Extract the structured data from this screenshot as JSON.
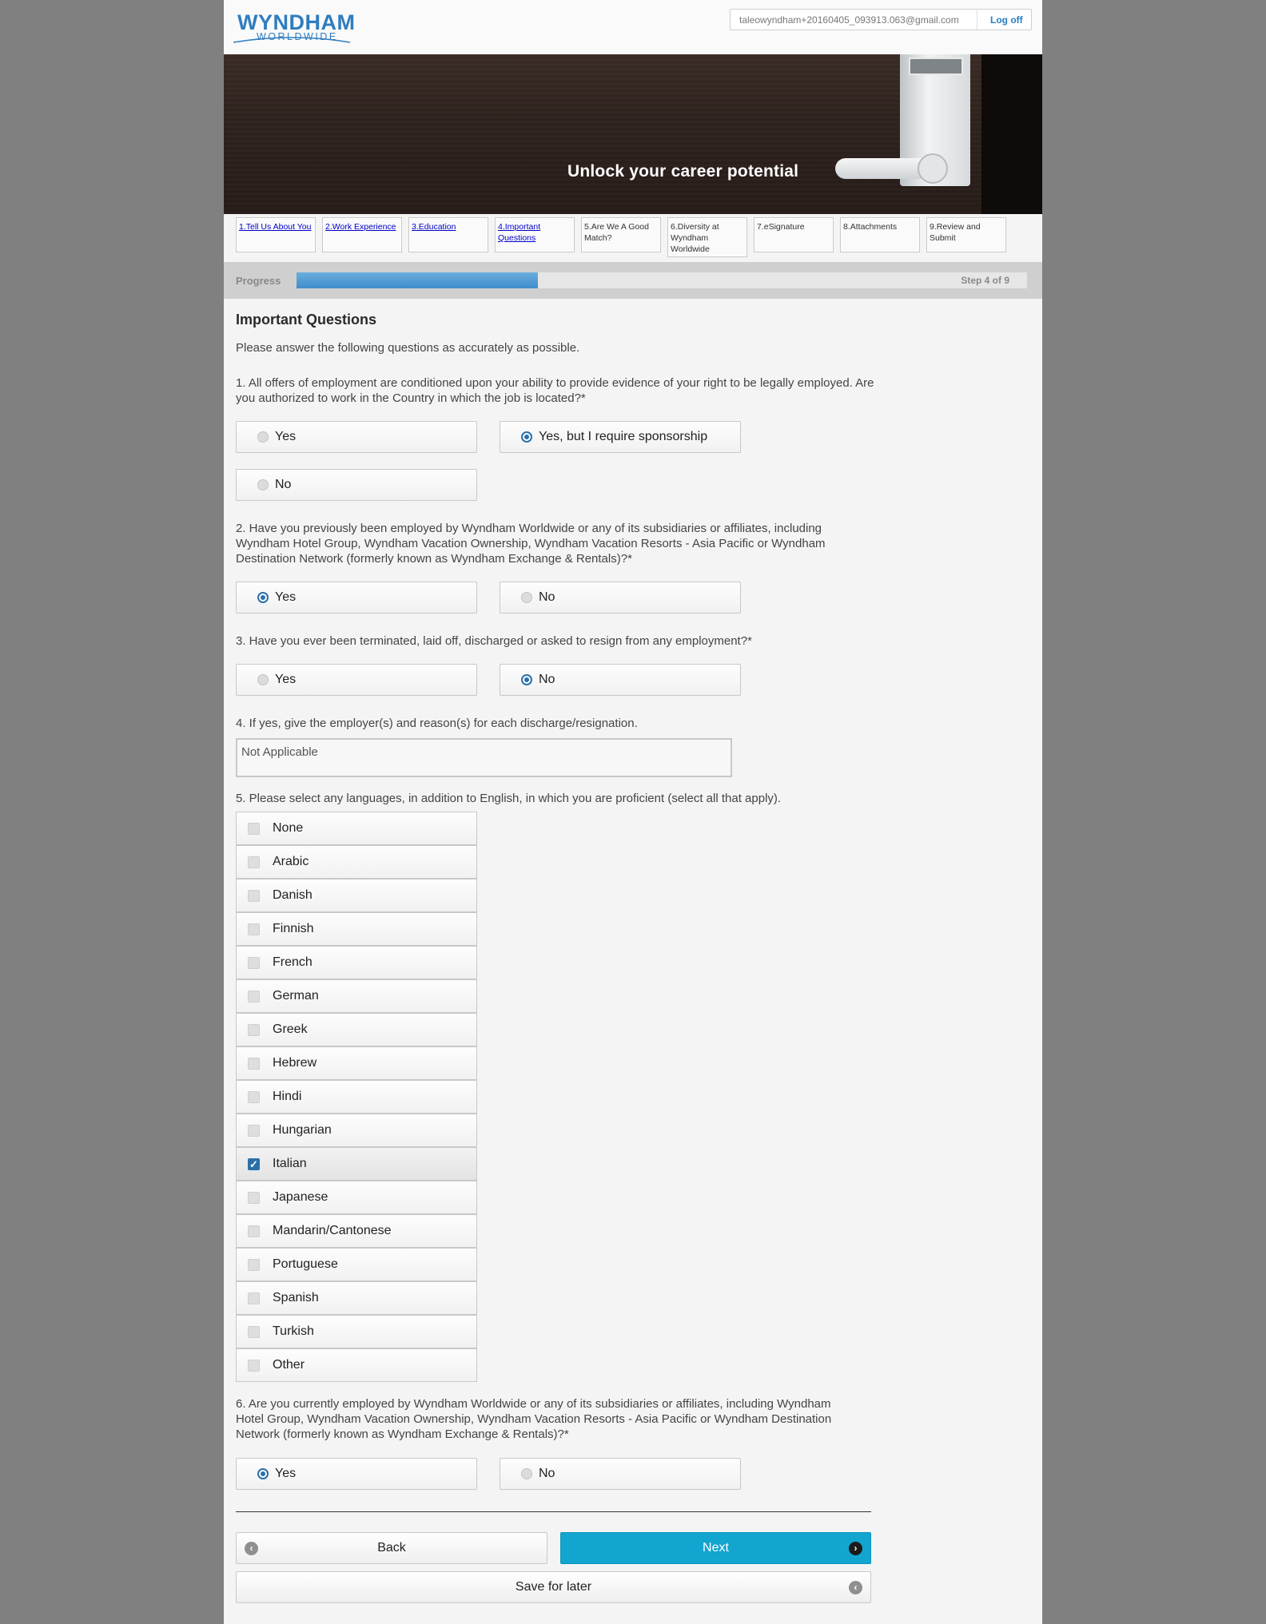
{
  "header": {
    "logo_line1": "WYNDHAM",
    "logo_line2": "WORLDWIDE",
    "user_email": "taleowyndham+20160405_093913.063@gmail.com",
    "logoff_label": "Log off"
  },
  "banner": {
    "tagline": "Unlock your career potential"
  },
  "steps": [
    {
      "label": "1.Tell Us About You",
      "link": true
    },
    {
      "label": "2.Work Experience",
      "link": true
    },
    {
      "label": "3.Education",
      "link": true
    },
    {
      "label": "4.Important Questions",
      "link": true
    },
    {
      "label": "5.Are We A Good Match?",
      "link": false
    },
    {
      "label": "6.Diversity at Wyndham Worldwide",
      "link": false
    },
    {
      "label": "7.eSignature",
      "link": false
    },
    {
      "label": "8.Attachments",
      "link": false
    },
    {
      "label": "9.Review and Submit",
      "link": false
    }
  ],
  "progress": {
    "label": "Progress",
    "step_text": "Step 4 of 9",
    "fraction": 0.33
  },
  "form": {
    "title": "Important Questions",
    "intro": "Please answer the following questions as accurately as possible.",
    "q1": {
      "text": "1. All offers of employment are conditioned upon your ability to provide evidence of your right to be legally employed. Are you authorized to work in the Country in which the job is located?*",
      "options": [
        "Yes",
        "Yes, but I require sponsorship",
        "No"
      ],
      "selected": "Yes, but I require sponsorship"
    },
    "q2": {
      "text": "2. Have you previously been employed by Wyndham Worldwide or any of its subsidiaries or affiliates, including Wyndham Hotel Group, Wyndham Vacation Ownership, Wyndham Vacation Resorts - Asia Pacific or Wyndham Destination Network (formerly known as Wyndham Exchange & Rentals)?*",
      "options": [
        "Yes",
        "No"
      ],
      "selected": "Yes"
    },
    "q3": {
      "text": "3. Have you ever been terminated, laid off, discharged or asked to resign from any employment?*",
      "options": [
        "Yes",
        "No"
      ],
      "selected": "No"
    },
    "q4": {
      "text": "4. If yes, give the employer(s) and reason(s) for each discharge/resignation.",
      "value": "Not Applicable"
    },
    "q5": {
      "text": "5. Please select any languages, in addition to English, in which you are proficient (select all that apply).",
      "options": [
        "None",
        "Arabic",
        "Danish",
        "Finnish",
        "French",
        "German",
        "Greek",
        "Hebrew",
        "Hindi",
        "Hungarian",
        "Italian",
        "Japanese",
        "Mandarin/Cantonese",
        "Portuguese",
        "Spanish",
        "Turkish",
        "Other"
      ],
      "selected": [
        "Italian"
      ]
    },
    "q6": {
      "text": "6. Are you currently employed by Wyndham Worldwide or any of its subsidiaries or affiliates, including Wyndham Hotel Group, Wyndham Vacation Ownership, Wyndham Vacation Resorts - Asia Pacific or Wyndham Destination Network (formerly known as Wyndham Exchange & Rentals)?*",
      "options": [
        "Yes",
        "No"
      ],
      "selected": "Yes"
    }
  },
  "buttons": {
    "back": "Back",
    "next": "Next",
    "save": "Save for later"
  },
  "colors": {
    "accent": "#12a5cf",
    "brand": "#2f7dbf",
    "radio_selected": "#2b6fa8"
  },
  "icons": {
    "back": "circle-arrow-left-icon",
    "next": "circle-arrow-right-icon",
    "save": "circle-arrow-left-icon"
  }
}
